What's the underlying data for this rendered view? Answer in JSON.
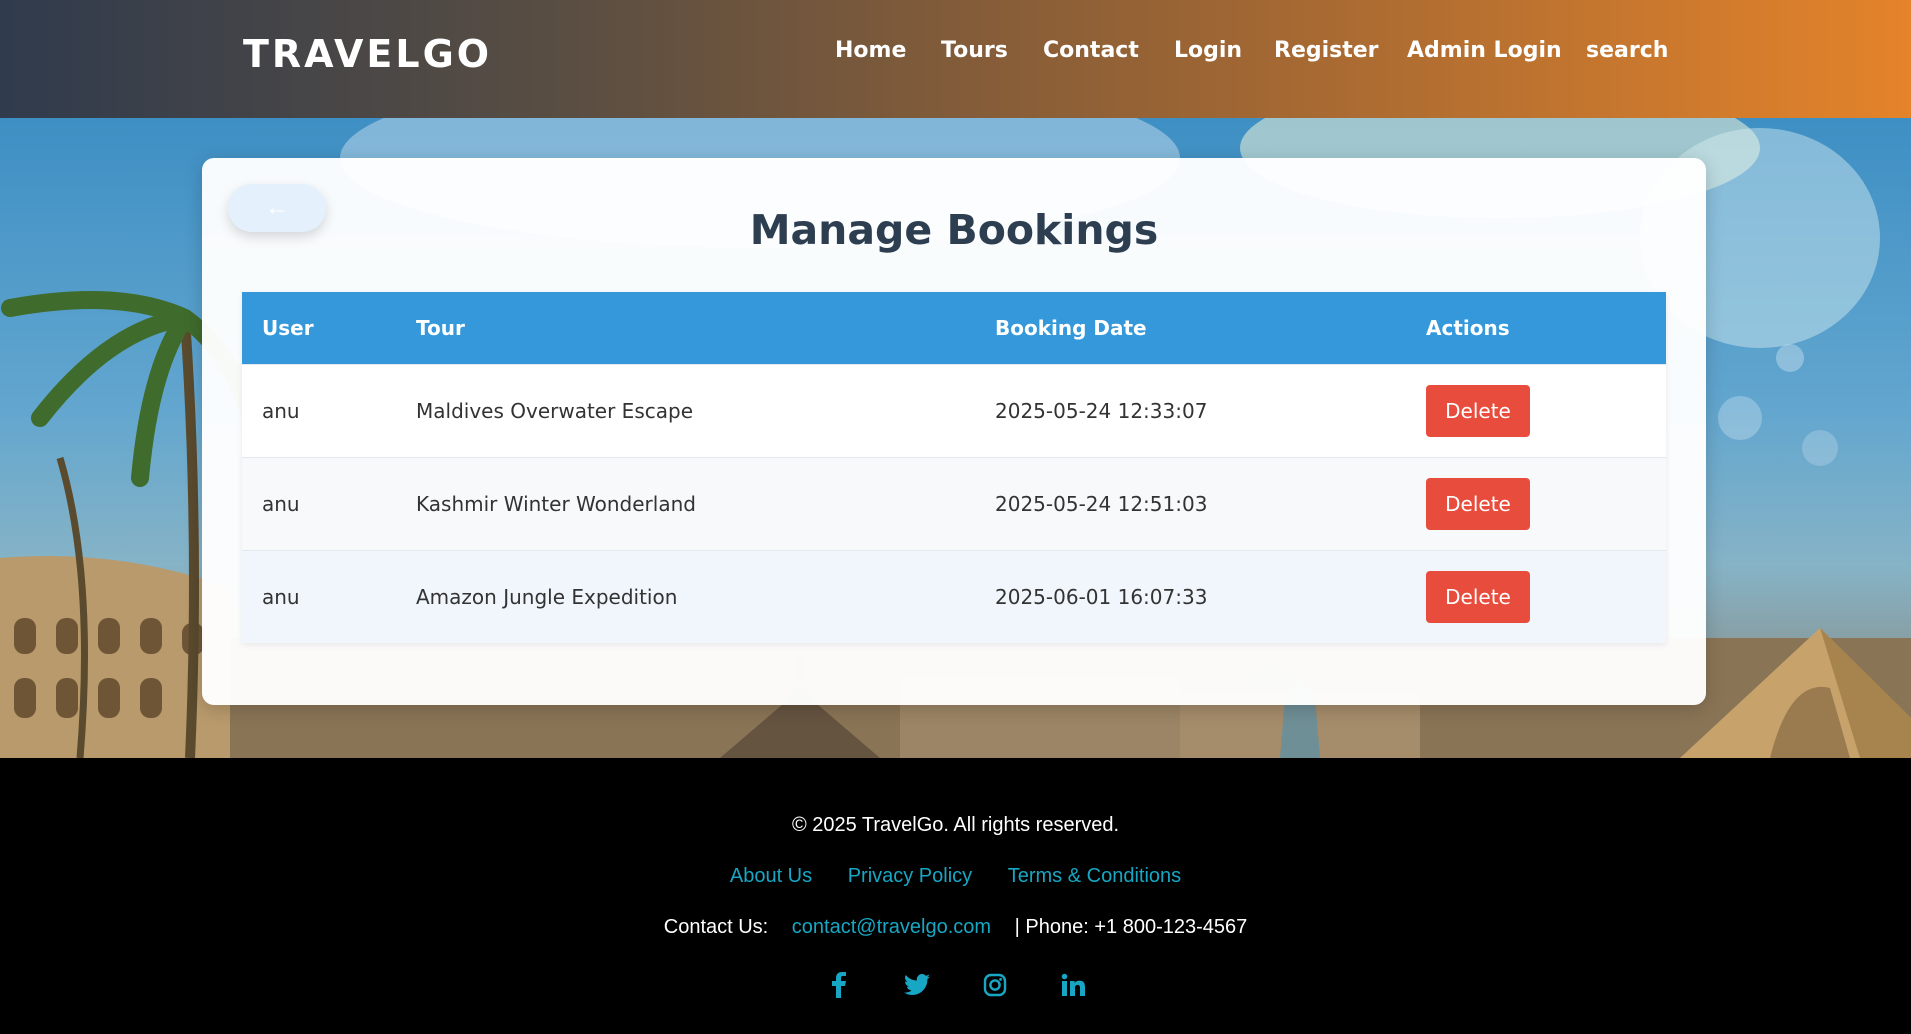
{
  "header": {
    "logo": "TRAVELGO",
    "nav": [
      "Home",
      "Tours",
      "Contact",
      "Login",
      "Register",
      "Admin Login",
      "search"
    ]
  },
  "card": {
    "back_icon": "arrow-left-icon",
    "title": "Manage Bookings",
    "table": {
      "columns": [
        "User",
        "Tour",
        "Booking Date",
        "Actions"
      ],
      "rows": [
        {
          "user": "anu",
          "tour": "Maldives Overwater Escape",
          "date": "2025-05-24 12:33:07",
          "action": "Delete"
        },
        {
          "user": "anu",
          "tour": "Kashmir Winter Wonderland",
          "date": "2025-05-24 12:51:03",
          "action": "Delete"
        },
        {
          "user": "anu",
          "tour": "Amazon Jungle Expedition",
          "date": "2025-06-01 16:07:33",
          "action": "Delete"
        }
      ]
    }
  },
  "footer": {
    "copyright": "© 2025 TravelGo. All rights reserved.",
    "links": [
      "About Us",
      "Privacy Policy",
      "Terms & Conditions"
    ],
    "contact_label": "Contact Us:",
    "contact_email": "contact@travelgo.com",
    "phone": "| Phone: +1 800-123-4567",
    "social_icons": [
      "facebook-icon",
      "twitter-icon",
      "instagram-icon",
      "linkedin-icon"
    ]
  },
  "colors": {
    "accent": "#3498db",
    "danger": "#e74c3c",
    "link": "#17a7c4",
    "title": "#2c3e50"
  }
}
